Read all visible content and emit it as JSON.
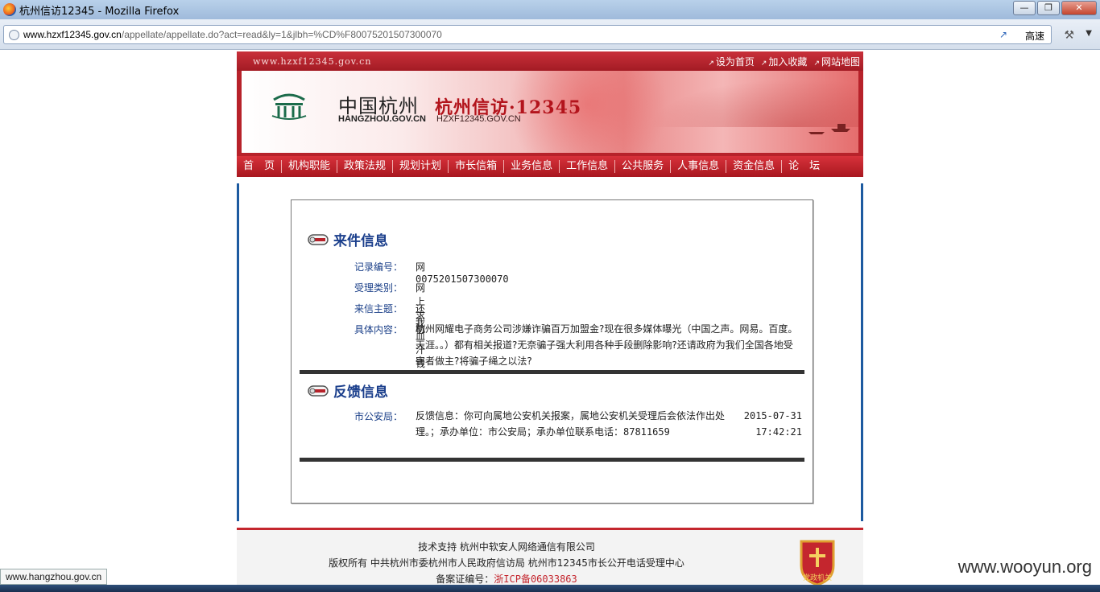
{
  "window": {
    "title": "杭州信访12345 - Mozilla Firefox",
    "buttons": {
      "minimize": "—",
      "maximize": "❐",
      "close": "✕"
    }
  },
  "toolbar": {
    "url_host": "www.hzxf12345.gov.cn",
    "url_path": "/appellate/appellate.do?act=read&ly=1&jlbh=%CD%F80075201507300070",
    "speed_label": "高速",
    "tools_icon": "⚒",
    "menu_icon": "▼"
  },
  "site": {
    "domain_text": "www.hzxf12345.gov.cn",
    "top_links": [
      "设为首页",
      "加入收藏",
      "网站地图"
    ],
    "banner": {
      "cn_name": "中国杭州",
      "cn_domain": "HANGZHOU.GOV.CN",
      "xf_name": "杭州信访·12345",
      "xf_domain": "HZXF12345.GOV.CN"
    },
    "menu": [
      "首　页",
      "机构职能",
      "政策法规",
      "规划计划",
      "市长信箱",
      "业务信息",
      "工作信息",
      "公共服务",
      "人事信息",
      "资金信息",
      "论　坛"
    ]
  },
  "record": {
    "section_title": "来件信息",
    "fields": [
      {
        "label": "记录编号：",
        "value": "网0075201507300070"
      },
      {
        "label": "受理类别：",
        "value": "网上求助"
      },
      {
        "label": "来信主题：",
        "value": "还我血汗钱"
      },
      {
        "label": "具体内容：",
        "value": "杭州网耀电子商务公司涉嫌诈骗百万加盟金?现在很多媒体曝光（中国之声。网易。百度。天涯。。）都有相关报道?无奈骗子强大利用各种手段删除影响?还请政府为我们全国各地受害者做主?将骗子绳之以法?"
      }
    ]
  },
  "feedback": {
    "section_title": "反馈信息",
    "label": "市公安局：",
    "text": "反馈信息：你可向属地公安机关报案，属地公安机关受理后会依法作出处理。；承办单位：市公安局；承办单位联系电话：87811659",
    "date": "2015-07-31",
    "time": "17:42:21"
  },
  "footer": {
    "support": "技术支持 杭州中软安人网络通信有限公司",
    "copyright": "版权所有 中共杭州市委杭州市人民政府信访局 杭州市12345市长公开电话受理中心",
    "icp_label": "备案证编号：",
    "icp_value": "浙ICP备06033863",
    "badge_text": "党政机关"
  },
  "status_bar": {
    "link_url": "www.hangzhou.gov.cn"
  },
  "watermark": "www.wooyun.org",
  "colors": {
    "brand_red": "#b7222a",
    "label_blue": "#1a3f88",
    "frame_blue": "#1d5aa0"
  }
}
